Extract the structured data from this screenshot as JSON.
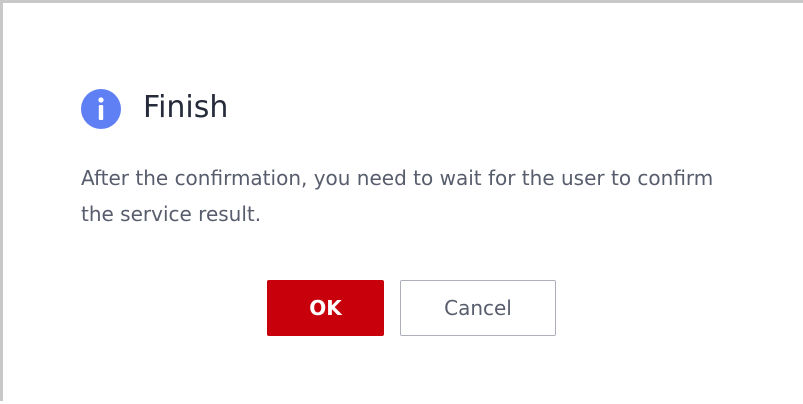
{
  "dialog": {
    "title": "Finish",
    "icon": "info-icon",
    "message": "After the confirmation, you need to wait for the user to confirm the service result.",
    "ok_label": "OK",
    "cancel_label": "Cancel"
  },
  "colors": {
    "icon_blue": "#5f80f4",
    "primary_red": "#c7000b",
    "title_text": "#252b3a",
    "body_text": "#575d6c",
    "cancel_border": "#adb0b8"
  }
}
